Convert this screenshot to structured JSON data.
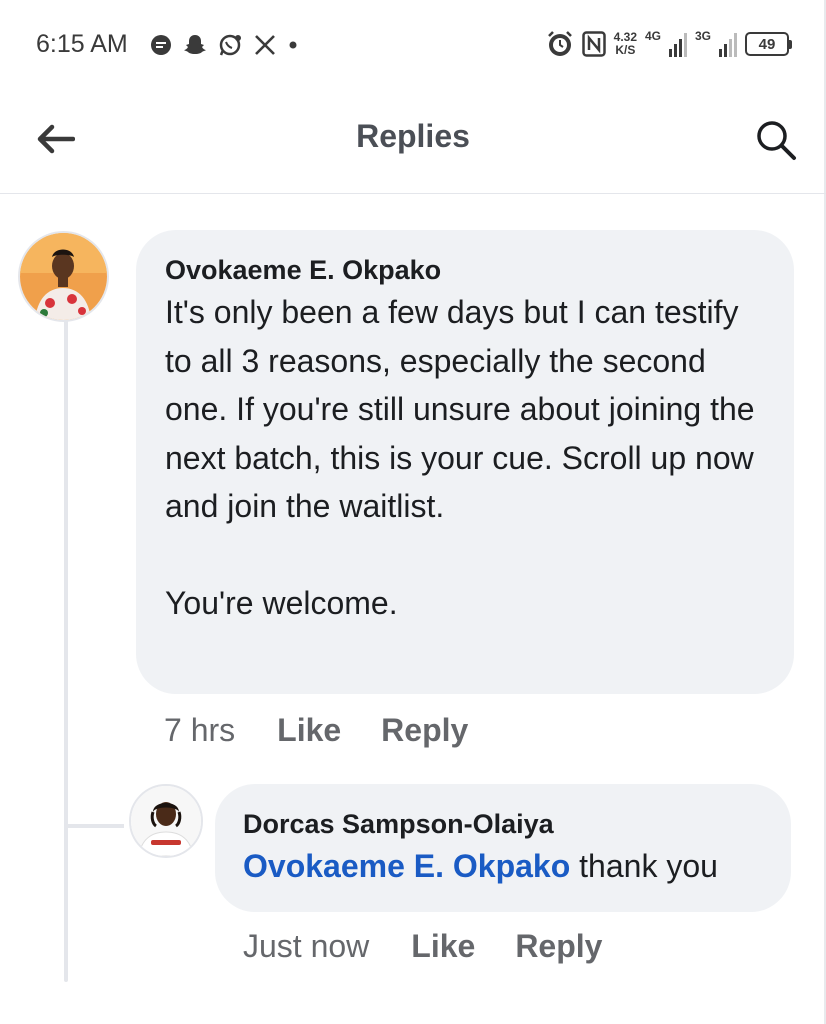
{
  "status_bar": {
    "time": "6:15 AM",
    "left_icons": [
      "chat-bubble-icon",
      "snapchat-icon",
      "whatsapp-icon",
      "x-icon",
      "dot-icon"
    ],
    "net_speed_value": "4.32",
    "net_speed_unit": "K/S",
    "signal_1_label": "4G",
    "signal_2_label": "3G",
    "battery_level": "49",
    "right_icons": [
      "alarm-icon",
      "nfc-icon"
    ]
  },
  "header": {
    "title": "Replies",
    "back_icon": "arrow-left-icon",
    "search_icon": "search-icon"
  },
  "comments": [
    {
      "author": "Ovokaeme E. Okpako",
      "text": "It's only been a few days but I can testify to all 3 reasons, especially the second one. If you're still unsure about joining the next batch, this is your cue. Scroll up now and join the waitlist.\n\nYou're welcome.",
      "time": "7 hrs",
      "like_label": "Like",
      "reply_label": "Reply"
    },
    {
      "author": "Dorcas Sampson-Olaiya",
      "mention": "Ovokaeme E. Okpako",
      "text": " thank you",
      "time": "Just now",
      "like_label": "Like",
      "reply_label": "Reply"
    }
  ],
  "colors": {
    "bubble_bg": "#f0f2f5",
    "mention": "#1a5bc4",
    "muted": "#65676b",
    "thread_line": "#e4e6eb"
  }
}
